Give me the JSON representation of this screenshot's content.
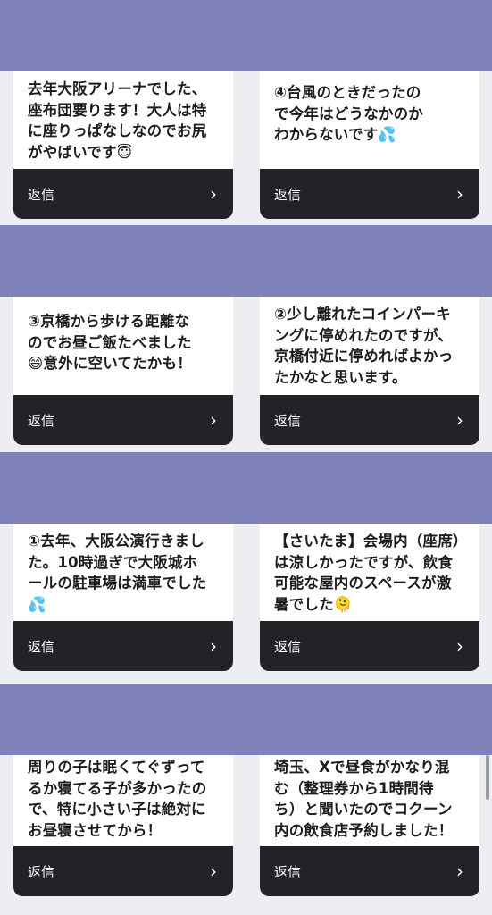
{
  "reply_label": "返信",
  "colors": {
    "band": "#7f82ba",
    "reply_bar": "#222327",
    "card": "#ffffff"
  },
  "icons": {
    "chevron": "chevron-right-icon"
  },
  "cards": [
    {
      "text": "去年大阪アリーナでした、\n座布団要ります！大人は特\nに座りっぱなしなのでお尻\nがやばいです😇"
    },
    {
      "text": "④台風のときだったの\nで今年はどうなかのか\nわからないです💦"
    },
    {
      "text": "③京橋から歩ける距離な\nのでお昼ご飯たべました\n😄意外に空いてたかも！"
    },
    {
      "text": "②少し離れたコインパーキ\nングに停めれたのですが、\n京橋付近に停めればよかっ\nたかなと思います。"
    },
    {
      "text": "①去年、大阪公演行きまし\nた。10時過ぎで大阪城ホ\nールの駐車場は満車でした\n💦"
    },
    {
      "text": "【さいたま】会場内（座席）\nは涼しかったですが、飲食\n可能な屋内のスペースが激\n暑でした🫠"
    },
    {
      "text": "周りの子は眠くてぐずって\nるか寝てる子が多かったの\nで、特に小さい子は絶対に\nお昼寝させてから！"
    },
    {
      "text": "埼玉、Xで昼食がかなり混\nむ（整理券から1時間待\nち）と聞いたのでコクーン\n内の飲食店予約しました！"
    }
  ]
}
